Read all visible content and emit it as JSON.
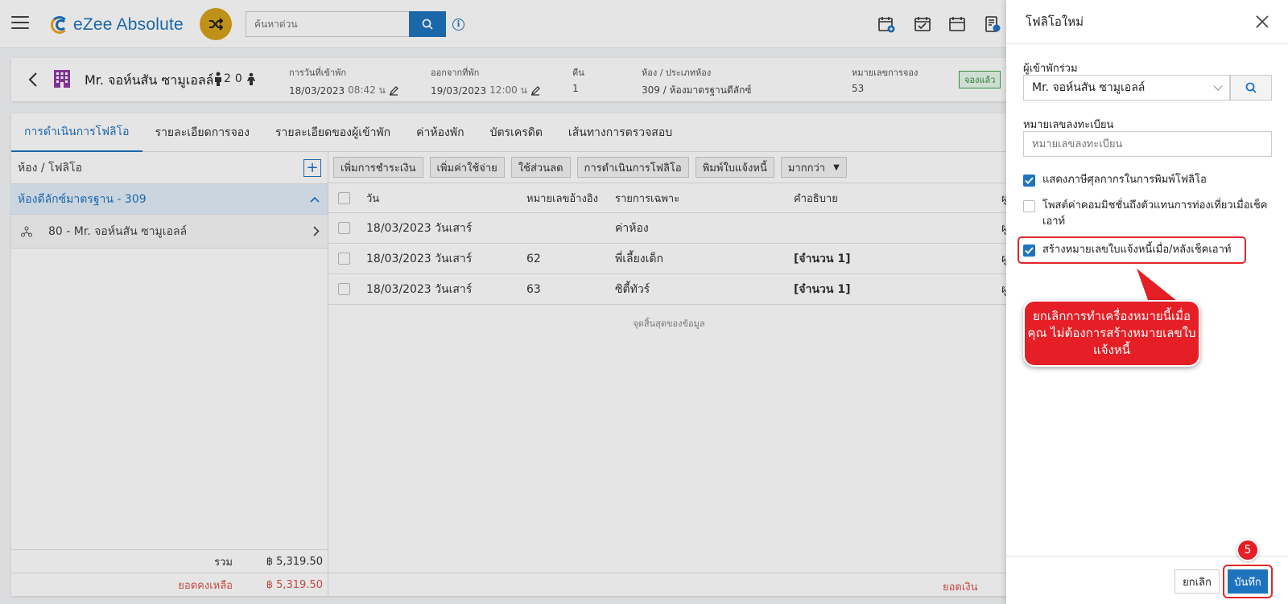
{
  "topbar": {
    "brand": "eZee Absolute",
    "search_placeholder": "ค้นหาด่วน",
    "info_glyph": "i",
    "icons": [
      "add-reservation-icon",
      "checklist-icon",
      "calendar-icon",
      "billing-icon"
    ]
  },
  "guest": {
    "name": "Mr. จอห์นสัน ซามูเอลล์",
    "adults": "2",
    "children": "0",
    "checkin_label": "การวันที่เข้าพัก",
    "checkin_value": "18/03/2023",
    "checkin_time": "08:42 น",
    "checkout_label": "ออกจากที่พัก",
    "checkout_value": "19/03/2023",
    "checkout_time": "12:00 น",
    "nights_label": "คืน",
    "nights_value": "1",
    "room_label": "ห้อง / ประเภทห้อง",
    "room_value": "309 / ห้องมาตรฐานดีลักซ์",
    "res_label": "หมายเลขการจอง",
    "res_value": "53",
    "status": "จองแล้ว"
  },
  "tabs": [
    {
      "label": "การดำเนินการโฟลิโอ",
      "active": true
    },
    {
      "label": "รายละเอียดการจอง"
    },
    {
      "label": "รายละเอียดของผู้เข้าพัก"
    },
    {
      "label": "ค่าห้องพัก"
    },
    {
      "label": "บัตรเครดิต"
    },
    {
      "label": "เส้นทางการตรวจสอบ"
    }
  ],
  "left_panel": {
    "header": "ห้อง / โฟลิโอ",
    "add_glyph": "+",
    "room_group": "ห้องดีลักซ์มาตรฐาน - 309",
    "folio_item": "80 - Mr. จอห์นสัน ซามูเอลล์",
    "total_label": "รวม",
    "total_value": "฿ 5,319.50",
    "balance_label": "ยอดคงเหลือ",
    "balance_value": "฿ 5,319.50"
  },
  "toolbar": {
    "add_payment": "เพิ่มการชำระเงิน",
    "add_charge": "เพิ่มค่าใช้จ่าย",
    "apply_discount": "ใช้ส่วนลด",
    "folio_ops": "การดำเนินการโฟลิโอ",
    "print_invoice": "พิมพ์ใบแจ้งหนี้",
    "more": "มากกว่า"
  },
  "table": {
    "headers": {
      "date": "วัน",
      "ref": "หมายเลขอ้างอิง",
      "particular": "รายการเฉพาะ",
      "desc": "คำอธิบาย",
      "extra": "ผู"
    },
    "rows": [
      {
        "date": "18/03/2023 วันเสาร์",
        "ref": "",
        "particular": "ค่าห้อง",
        "desc": "",
        "extra": "ผู"
      },
      {
        "date": "18/03/2023 วันเสาร์",
        "ref": "62",
        "particular": "พี่เลี้ยงเด็ก",
        "desc": "[จำนวน 1]",
        "extra": "ผู"
      },
      {
        "date": "18/03/2023 วันเสาร์",
        "ref": "63",
        "particular": "ซิตี้ทัวร์",
        "desc": "[จำนวน 1]",
        "extra": "ผู"
      }
    ],
    "end_of_data": "จุดสิ้นสุดของข้อมูล",
    "footer_label": "ยอดเงิน"
  },
  "drawer": {
    "title": "โฟลิโอใหม่",
    "guest_label": "ผู้เข้าพักร่วม",
    "guest_value": "Mr. จอห์นสัน ซามูเอลล์",
    "reg_label": "หมายเลขลงทะเบียน",
    "reg_placeholder": "หมายเลขลงทะเบียน",
    "opt1": "แสดงภาษีศุลกากรในการพิมพ์โฟลิโอ",
    "opt1_checked": true,
    "opt2": "โพสต์ค่าคอมมิชชั่นถึงตัวแทนการท่องเที่ยวเมื่อเช็คเอาท์",
    "opt2_checked": false,
    "opt3": "สร้างหมายเลขใบแจ้งหนี้เมื่อ/หลังเช็คเอาท์",
    "opt3_checked": true,
    "callout": "ยกเลิกการทำเครื่องหมายนี้เมื่อคุณ ไม่ต้องการสร้างหมายเลขใบแจ้งหนี้",
    "cancel_label": "ยกเลิก",
    "save_label": "บันทึก",
    "step_number": "5"
  },
  "colors": {
    "accent": "#1e73be",
    "highlight": "#e2262a",
    "callout": "#e61e25",
    "badge": "#d6a21a"
  }
}
